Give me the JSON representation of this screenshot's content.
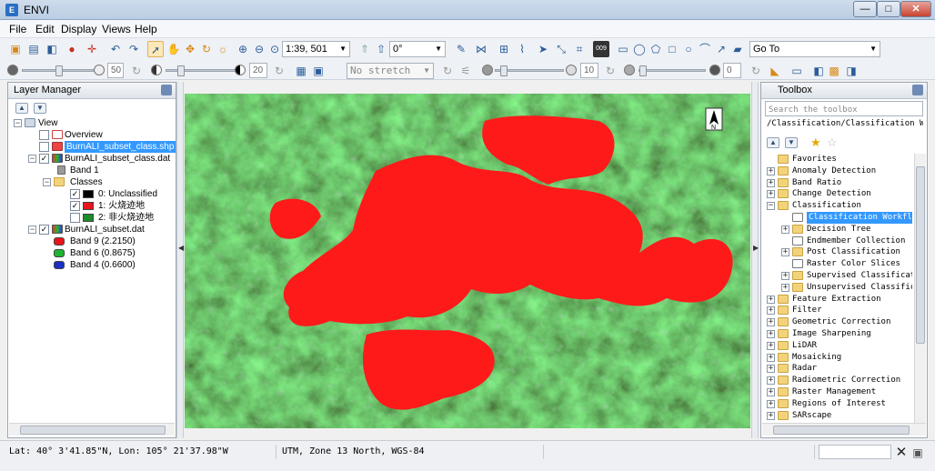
{
  "window": {
    "title": "ENVI",
    "controls": {
      "minimize": "—",
      "maximize": "□",
      "close": "✕"
    }
  },
  "menu": [
    "File",
    "Edit",
    "Display",
    "Views",
    "Help"
  ],
  "toolbar": {
    "scale_value": "1:39, 501",
    "rotation_value": "0°",
    "goto_placeholder": "Go To",
    "brightness_value": "50",
    "contrast_value": "20",
    "stretch_value": "No stretch",
    "sharpen_value": "10",
    "transparency_value": "0",
    "icons": [
      "open-icon",
      "undo-icon",
      "redo-icon",
      "select-icon",
      "pan-icon",
      "zoom-in-icon",
      "zoom-out-icon",
      "rotate-icon",
      "goto-icon"
    ]
  },
  "layer_manager": {
    "title": "Layer Manager",
    "tree": [
      {
        "label": "View"
      },
      {
        "label": "Overview"
      },
      {
        "label": "BurnALI_subset_class.shp"
      },
      {
        "label": "BurnALI_subset_class.dat"
      },
      {
        "label": "Band 1"
      },
      {
        "label": "Classes"
      },
      {
        "label": "0: Unclassified",
        "color": "#000000"
      },
      {
        "label": "1: 火烧迹地",
        "color": "#e8151b"
      },
      {
        "label": "2: 非火烧迹地",
        "color": "#1a8c2a"
      },
      {
        "label": "BurnALI_subset.dat"
      },
      {
        "label": "Band 9 (2.2150)",
        "color": "#e8151b"
      },
      {
        "label": "Band 6 (0.8675)",
        "color": "#1fb330"
      },
      {
        "label": "Band 4 (0.6600)",
        "color": "#1b2fc2"
      }
    ]
  },
  "toolbox": {
    "title": "Toolbox",
    "search_placeholder": "Search the toolbox",
    "path": "/Classification/Classification Workflow",
    "items": [
      {
        "label": "Favorites",
        "level": 0
      },
      {
        "label": "Anomaly Detection",
        "level": 0
      },
      {
        "label": "Band Ratio",
        "level": 0
      },
      {
        "label": "Change Detection",
        "level": 0
      },
      {
        "label": "Classification",
        "level": 0
      },
      {
        "label": "Classification Workflow",
        "level": 1
      },
      {
        "label": "Decision Tree",
        "level": 1
      },
      {
        "label": "Endmember Collection",
        "level": 1
      },
      {
        "label": "Post Classification",
        "level": 1
      },
      {
        "label": "Raster Color Slices",
        "level": 1
      },
      {
        "label": "Supervised Classification",
        "level": 1
      },
      {
        "label": "Unsupervised Classification",
        "level": 1
      },
      {
        "label": "Feature Extraction",
        "level": 0
      },
      {
        "label": "Filter",
        "level": 0
      },
      {
        "label": "Geometric Correction",
        "level": 0
      },
      {
        "label": "Image Sharpening",
        "level": 0
      },
      {
        "label": "LiDAR",
        "level": 0
      },
      {
        "label": "Mosaicking",
        "level": 0
      },
      {
        "label": "Radar",
        "level": 0
      },
      {
        "label": "Radiometric Correction",
        "level": 0
      },
      {
        "label": "Raster Management",
        "level": 0
      },
      {
        "label": "Regions of Interest",
        "level": 0
      },
      {
        "label": "SARscape",
        "level": 0
      }
    ]
  },
  "map": {
    "north_label": "N",
    "burn_color": "#ff1a1a"
  },
  "status": {
    "latlon": "Lat: 40° 3'41.85\"N, Lon: 105° 21'37.98\"W",
    "projection": "UTM, Zone 13 North, WGS-84"
  }
}
